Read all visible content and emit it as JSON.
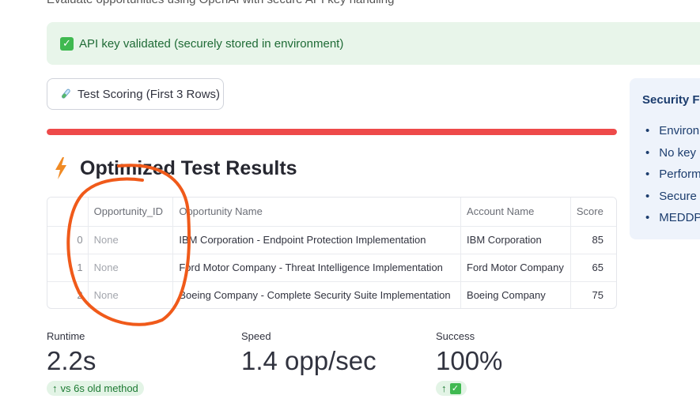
{
  "caption": "Evaluate opportunities using OpenAI with secure API key handling",
  "alert": {
    "text": "API key validated (securely stored in environment)"
  },
  "test_button": {
    "label": "Test Scoring (First 3 Rows)",
    "icon": "test-tube-icon"
  },
  "progress": {
    "fraction": 1.0,
    "color": "#ee4a4a"
  },
  "results": {
    "title": "Optimized Test Results",
    "icon": "lightning-bolt-icon",
    "columns": [
      "",
      "Opportunity_ID",
      "Opportunity Name",
      "Account Name",
      "Score"
    ],
    "rows": [
      {
        "index": "0",
        "id": "None",
        "name": "IBM Corporation - Endpoint Protection Implementation",
        "account": "IBM Corporation",
        "score": "85"
      },
      {
        "index": "1",
        "id": "None",
        "name": "Ford Motor Company - Threat Intelligence Implementation",
        "account": "Ford Motor Company",
        "score": "65"
      },
      {
        "index": "2",
        "id": "None",
        "name": "Boeing Company - Complete Security Suite Implementation",
        "account": "Boeing Company",
        "score": "75"
      }
    ]
  },
  "sidebar": {
    "title": "Security Fe",
    "items": [
      "Environ",
      "No key",
      "Perform",
      "Secure",
      "MEDDP"
    ]
  },
  "metrics": [
    {
      "label": "Runtime",
      "value": "2.2s",
      "delta": "vs 6s old method"
    },
    {
      "label": "Speed",
      "value": "1.4 opp/sec",
      "delta": ""
    },
    {
      "label": "Success",
      "value": "100%",
      "delta": ""
    }
  ],
  "colors": {
    "accent_red": "#ee4a4a",
    "success_green": "#3fb950",
    "annotation_orange": "#f05a1a"
  }
}
